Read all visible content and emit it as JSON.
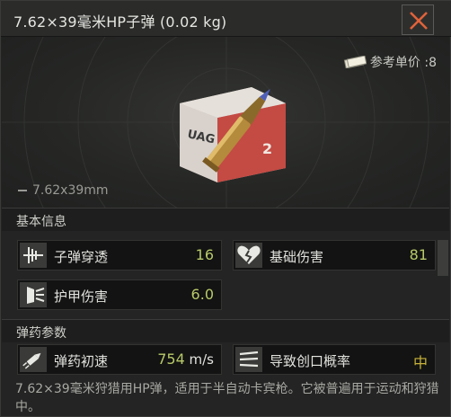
{
  "window": {
    "title": "7.62×39毫米HP子弹 (0.02 kg)"
  },
  "preview": {
    "price_label": "参考单价 :8",
    "caliber_label": "7.62x39mm",
    "box_text": "UAG",
    "box_number": "2"
  },
  "sections": {
    "basic_info": "基本信息",
    "ammo_params": "弹药参数"
  },
  "stats": {
    "penetration": {
      "label": "子弹穿透",
      "value": "16"
    },
    "base_damage": {
      "label": "基础伤害",
      "value": "81"
    },
    "armor_damage": {
      "label": "护甲伤害",
      "value": "6.0"
    },
    "muzzle_velocity": {
      "label": "弹药初速",
      "value": "754",
      "unit": " m/s"
    },
    "bleed_chance": {
      "label": "导致创口概率",
      "value": "中"
    }
  },
  "description": "7.62×39毫米狩猎用HP弹，适用于半自动卡宾枪。它被普遍用于运动和狩猎中。",
  "icons": {
    "close": "close-icon",
    "cash": "cash-icon",
    "penetration": "penetration-icon",
    "damage": "broken-heart-icon",
    "armor": "armor-damage-icon",
    "velocity": "bullet-velocity-icon",
    "bleed": "bleed-icon"
  },
  "colors": {
    "accent_orange": "#e0623a",
    "value_green": "#b8c96a",
    "value_gold": "#c8b23a"
  }
}
